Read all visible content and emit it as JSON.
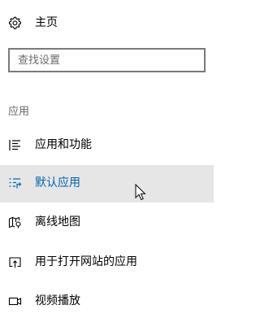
{
  "home": {
    "icon": "gear-icon",
    "label": "主页"
  },
  "search": {
    "placeholder": "查找设置",
    "value": ""
  },
  "section": {
    "title": "应用"
  },
  "nav": {
    "items": [
      {
        "label": "应用和功能",
        "icon": "apps-features-list-icon",
        "selected": false
      },
      {
        "label": "默认应用",
        "icon": "default-apps-icon",
        "selected": true
      },
      {
        "label": "离线地图",
        "icon": "offline-maps-icon",
        "selected": false
      },
      {
        "label": "用于打开网站的应用",
        "icon": "apps-for-websites-icon",
        "selected": false
      },
      {
        "label": "视频播放",
        "icon": "video-playback-icon",
        "selected": false
      }
    ]
  },
  "colors": {
    "accent": "#0063b1",
    "selected_background": "#e6e6e6",
    "section_text": "#666666",
    "search_border": "#7a7a7a"
  }
}
